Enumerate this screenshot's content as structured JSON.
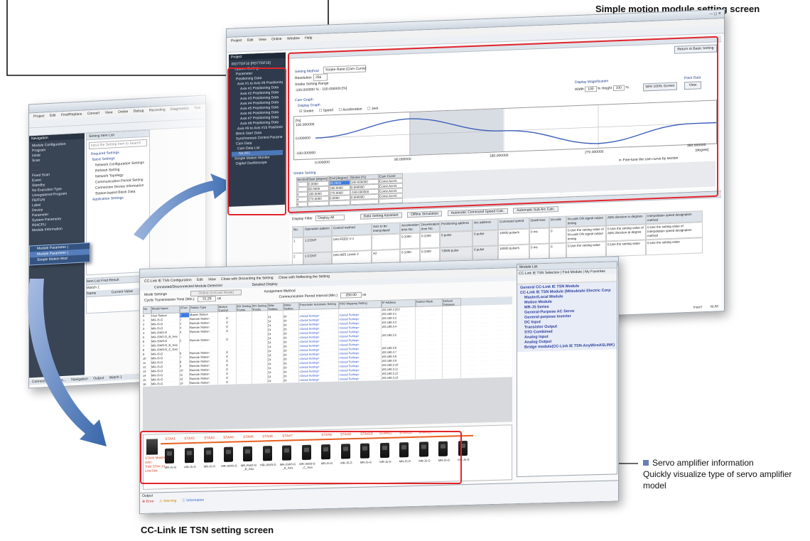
{
  "captions": {
    "simple_motion": "Simple motion module setting screen",
    "cclink": "CC-Link IE TSN setting screen",
    "servo_title": "Servo amplifier information",
    "servo_desc": "Quickly visualize type of servo amplifier model"
  },
  "gxworks": {
    "menu": [
      "Project",
      "Edit",
      "Find/Replace",
      "Convert",
      "View",
      "Online",
      "Debug",
      "Recording",
      "Diagnostics",
      "Tool"
    ],
    "nav_title": "Navigation",
    "tree": [
      "Module Configuration",
      "Program",
      "Initial",
      "Scan",
      "Fixed Scan",
      "Event",
      "Standby",
      "No Execution Type",
      "Unregistered Program",
      "FB/FUN",
      "Label",
      "Device",
      "Parameter",
      "System Parameter",
      "R04CPU",
      "Module Information"
    ],
    "popup": [
      "Module Parameter (",
      "Module Parameter (",
      "Simple Motion Mod"
    ],
    "setting_title": "Setting Item List",
    "setting_search": "Input the Setting Item to Search",
    "setting_tree": [
      "Required Settings",
      "Basic Settings",
      "Network Configuration Settings",
      "Refresh Setting",
      "Network Topology",
      "Communication Period Setting",
      "Connection Device Information",
      "Station-based Block Data",
      "Application Settings"
    ],
    "item_list_tab": "Item List",
    "find_result_tab": "Find Result",
    "watch_title": "Watch 1",
    "watch_col1": "Name",
    "watch_col2": "Current Value",
    "bottom_tabs": [
      "Connection Destina...",
      "Navigation",
      "Output",
      "Watch 1"
    ]
  },
  "motion": {
    "menu": [
      "Project",
      "Edit",
      "View",
      "Online",
      "Window",
      "Help"
    ],
    "project_title": "Project",
    "tree": [
      "RD77GF16 [RD77GF16]",
      "System Setting",
      "Parameter",
      "Positioning Data",
      "Axis #1 to Axis #8 Positioning",
      "Axis #1 Positioning Data",
      "Axis #2 Positioning Data",
      "Axis #3 Positioning Data",
      "Axis #4 Positioning Data",
      "Axis #5 Positioning Data",
      "Axis #6 Positioning Data",
      "Axis #7 Positioning Data",
      "Axis #8 Positioning Data",
      "Axis #9 to Axis #16 Positioning",
      "Block Start Data",
      "Synchronous Control Parameter",
      "Cam Data",
      "Cam Data List",
      "No.001",
      "Simple Motion Monitor",
      "Digital Oscilloscope"
    ],
    "return_btn": "Return to Basic Setting",
    "setting_method_label": "Setting Method",
    "setting_method_value": "Stroke Ratio (Cam Curve)",
    "resolution_label": "Resolution",
    "resolution_value": "256",
    "stroke_range_label": "Stroke Setting Range",
    "stroke_range_value": "-100.000000 % - 100.000000 [%]",
    "cam_graph_label": "Cam Graph",
    "display_graph_label": "Display Graph",
    "legend": [
      "Stroke",
      "Speed",
      "Acceleration",
      "Jerk"
    ],
    "display_mag": "Display Magnification",
    "width_label": "Width",
    "width_value": "100",
    "height_label": "% Height",
    "height_value": "100",
    "pct": "%",
    "fit_btn": "W/H 100% Screen",
    "point_data": "Point Data",
    "view_btn": "View",
    "y_unit": "[%]",
    "y_ticks": [
      "100.000000",
      "0.000000",
      "-100.000000"
    ],
    "x_ticks": [
      "0.000000",
      "90.000000",
      "180.000000",
      "270.000000",
      "360.000000"
    ],
    "x_unit": "[degree]",
    "stroke_setting": "Stroke Setting",
    "finetune": "Fine-tune the cam curve by section",
    "table_head": [
      "Section",
      "Start [degree]",
      "End [degree]",
      "Stroke [%]",
      "Cam Curve"
    ],
    "table_rows": [
      [
        "1",
        "0.0000",
        "90.0000",
        "100.000000",
        "Const.Accel."
      ],
      [
        "2",
        "90.0000",
        "180.0000",
        "0.000000",
        "Const.Accel."
      ],
      [
        "3",
        "180.0000",
        "270.0000",
        "-100.000000",
        "Const.Accel."
      ],
      [
        "4",
        "270.0000",
        "0.0000",
        "0.000000",
        "Const.Accel."
      ],
      [
        "5",
        "",
        "",
        "",
        ""
      ],
      [
        "6",
        "",
        "",
        "",
        ""
      ]
    ],
    "pos_toolbar": [
      "Display Filter",
      "Display All",
      "Data Setting Assistant",
      "Offline Simulation",
      "Automatic Command Speed Calc.",
      "Automatic Sub Arc Calc."
    ],
    "pos_head": [
      "No.",
      "Operation pattern",
      "Control method",
      "Axis to be interpolated",
      "Acceleration time No.",
      "Deceleration time No.",
      "Positioning address",
      "Arc address",
      "Command speed",
      "Dwell time",
      "M-code",
      "M-code ON signal output timing",
      "ABS direction in degrees",
      "Interpolation speed designation method"
    ],
    "pos_rows": [
      [
        "1",
        "1:CONT",
        "0Ah:FEED V-1",
        "-",
        "0:1000",
        "0:1000",
        "0 pulse",
        "0 pulse",
        "10000 pulse/s",
        "0 ms",
        "0",
        "0:Use the setting value of M-code ON signal output timing",
        "0:Use the setting value of ABS direction at degree",
        "0:Use the setting value of Interpolation speed designation method"
      ],
      [
        "2",
        "1:CONT",
        "0Ah:ABS Linear 2",
        "A2",
        "0:1000",
        "0:1000",
        "73608 pulse",
        "0 pulse",
        "10000 pulse/s",
        "0 ms",
        "0",
        "0:Use the setting value",
        "0:Use the setting value",
        "0:Use the setting value"
      ]
    ],
    "status": [
      "Insert",
      "NUM"
    ]
  },
  "cclink": {
    "title": "CC-Link IE TSN Configuration",
    "menu": [
      "Edit",
      "View",
      "Close with Discarding the Setting",
      "Close with Reflecting the Setting"
    ],
    "tabs": [
      "Connected/Disconnected Module Detection",
      "Detailed Display"
    ],
    "mode_label": "Mode Settings",
    "mode_value": "Online (Unicast Mode)",
    "cyclic_label": "Cyclic Transmission Time (Min.)",
    "cyclic_value": "31.25",
    "us": "us",
    "assign_label": "Assignment Method",
    "comm_label": "Communication Period Interval (Min.)",
    "comm_value": "250.00",
    "head": [
      "No.",
      "Model Name",
      "STA#",
      "Station Type",
      "Motion Control Station",
      "RX Setting Points",
      "RY Setting Points",
      "RWr Setting Points",
      "RWw Setting Points",
      "Parameter Automatic Setting",
      "PDO Mapping Setting",
      "IP Address",
      "Subnet Mask",
      "Default Gateway"
    ],
    "rows": [
      [
        "0",
        "Host Station",
        "0",
        "Master Station",
        "",
        "",
        "",
        "",
        "",
        "",
        "",
        "192.168.3.253"
      ],
      [
        "1",
        "MR-J5-G",
        "1",
        "Remote Station",
        "true",
        "",
        "",
        "24",
        "20",
        "<Detail Setting>",
        "<Detail Setting>",
        "192.168.3.1"
      ],
      [
        "2",
        "MR-J5-G",
        "2",
        "Remote Station",
        "true",
        "",
        "",
        "24",
        "20",
        "<Detail Setting>",
        "<Detail Setting>",
        "192.168.3.2"
      ],
      [
        "3",
        "MR-J5-G",
        "3",
        "Remote Station",
        "true",
        "",
        "",
        "24",
        "20",
        "<Detail Setting>",
        "<Detail Setting>",
        "192.168.3.3"
      ],
      [
        "4",
        "MR-J5W2-G",
        "4",
        "Remote Station",
        "true",
        "",
        "",
        "24",
        "20",
        "<Detail Setting>",
        "<Detail Setting>",
        "192.168.3.4"
      ],
      [
        "5",
        "MR-J5W2-G_B_Axis",
        "",
        "",
        "",
        "",
        "",
        "24",
        "20",
        "<Detail Setting>",
        "<Detail Setting>",
        ""
      ],
      [
        "6",
        "MR-J5W3-G",
        "5",
        "Remote Station",
        "true",
        "",
        "",
        "24",
        "20",
        "<Detail Setting>",
        "<Detail Setting>",
        "192.168.3.5"
      ],
      [
        "7",
        "MR-J5W3-G_B_Axis",
        "",
        "",
        "",
        "",
        "",
        "24",
        "20",
        "<Detail Setting>",
        "<Detail Setting>",
        ""
      ],
      [
        "8",
        "MR-J5W3-G_C_Axis",
        "",
        "",
        "",
        "",
        "",
        "24",
        "20",
        "<Detail Setting>",
        "<Detail Setting>",
        ""
      ],
      [
        "9",
        "MR-J5-G",
        "6",
        "Remote Station",
        "true",
        "",
        "",
        "24",
        "20",
        "<Detail Setting>",
        "<Detail Setting>",
        "192.168.3.6"
      ],
      [
        "10",
        "MR-J5-G",
        "7",
        "Remote Station",
        "true",
        "",
        "",
        "24",
        "20",
        "<Detail Setting>",
        "<Detail Setting>",
        "192.168.3.7"
      ],
      [
        "11",
        "MR-J5-G",
        "8",
        "Remote Station",
        "true",
        "",
        "",
        "24",
        "20",
        "<Detail Setting>",
        "<Detail Setting>",
        "192.168.3.8"
      ],
      [
        "12",
        "MR-J5-G",
        "9",
        "Remote Station",
        "true",
        "",
        "",
        "24",
        "20",
        "<Detail Setting>",
        "<Detail Setting>",
        "192.168.3.9"
      ],
      [
        "13",
        "MR-J5-G",
        "10",
        "Remote Station",
        "true",
        "",
        "",
        "24",
        "20",
        "<Detail Setting>",
        "<Detail Setting>",
        "192.168.3.10"
      ],
      [
        "14",
        "MR-J5-G",
        "11",
        "Remote Station",
        "true",
        "",
        "",
        "24",
        "20",
        "<Detail Setting>",
        "<Detail Setting>",
        "192.168.3.11"
      ],
      [
        "15",
        "MR-J5-G",
        "12",
        "Remote Station",
        "true",
        "",
        "",
        "24",
        "20",
        "<Detail Setting>",
        "<Detail Setting>",
        "192.168.3.12"
      ],
      [
        "16",
        "MR-J5-G",
        "13",
        "Remote Station",
        "true",
        "",
        "",
        "24",
        "20",
        "<Detail Setting>",
        "<Detail Setting>",
        "192.168.3.13"
      ]
    ],
    "host_label": [
      "STA#0 Master St",
      "ation",
      "Total STA#:13",
      "Line/Star"
    ],
    "stations": [
      "STA#1",
      "STA#2",
      "STA#3",
      "STA#4",
      "STA#5",
      "STA#6",
      "STA#7",
      "STA#8",
      "STA#9",
      "STA#10",
      "STA#11",
      "STA#12",
      "STA#13"
    ],
    "amp_labels": [
      "MR-J5-G",
      "MR-J5-G",
      "MR-J5-G",
      "MR-J5W2-G",
      "MR-J5W2-G _B_Axis",
      "MR-J5W3-G",
      "MR-J5W3-G _B_Axis",
      "MR-J5W3-G _C_Axis",
      "MR-J5-G",
      "MR-J5-G",
      "MR-J5-G",
      "MR-J5-G",
      "MR-J5-G",
      "MR-J5-G",
      "MR-J5-G",
      "MR-J5-G"
    ],
    "output_label": "Output",
    "output_tabs": [
      "Error",
      "Warning",
      "Information"
    ]
  },
  "module_list": {
    "title": "Module List",
    "tabs": [
      "CC-Link IE TSN Selection",
      "Find Module",
      "My Favorites"
    ],
    "items": [
      "General CC-Link IE TSN Module",
      "CC-Link IE TSN Module (Mitsubishi Electric Corp",
      "Master/Local Module",
      "Motion Module",
      "MR-J5 Series",
      "General-Purpose AC Servo",
      "General-purpose Inverter",
      "DC Input",
      "Transistor Output",
      "STO Combined",
      "Analog Input",
      "Analog Output",
      "Bridge module(CC-Link IE TSN-AnyWireASLINK)"
    ]
  }
}
